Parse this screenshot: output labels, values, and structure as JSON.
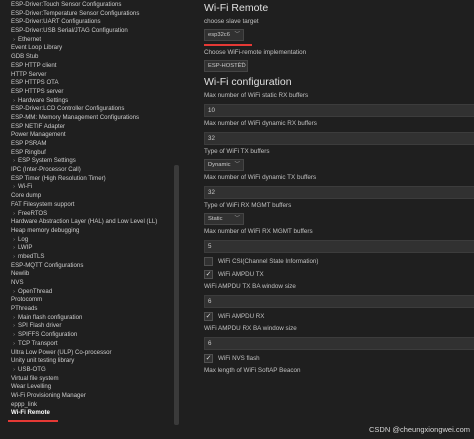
{
  "sidebar": {
    "items": [
      {
        "label": "ESP-Driver:Touch Sensor Configurations",
        "indent": 0,
        "chevron": false
      },
      {
        "label": "ESP-Driver:Temperature Sensor Configurations",
        "indent": 0,
        "chevron": false
      },
      {
        "label": "ESP-Driver:UART Configurations",
        "indent": 0,
        "chevron": false
      },
      {
        "label": "ESP-Driver:USB Serial/JTAG Configuration",
        "indent": 0,
        "chevron": false
      },
      {
        "label": "Ethernet",
        "indent": 1,
        "chevron": true
      },
      {
        "label": "Event Loop Library",
        "indent": 0,
        "chevron": false
      },
      {
        "label": "GDB Stub",
        "indent": 0,
        "chevron": false
      },
      {
        "label": "ESP HTTP client",
        "indent": 0,
        "chevron": false
      },
      {
        "label": "HTTP Server",
        "indent": 0,
        "chevron": false
      },
      {
        "label": "ESP HTTPS OTA",
        "indent": 0,
        "chevron": false
      },
      {
        "label": "ESP HTTPS server",
        "indent": 0,
        "chevron": false
      },
      {
        "label": "Hardware Settings",
        "indent": 1,
        "chevron": true
      },
      {
        "label": "ESP-Driver:LCD Controller Configurations",
        "indent": 0,
        "chevron": false
      },
      {
        "label": "ESP-MM: Memory Management Configurations",
        "indent": 0,
        "chevron": false
      },
      {
        "label": "ESP NETIF Adapter",
        "indent": 0,
        "chevron": false
      },
      {
        "label": "Power Management",
        "indent": 0,
        "chevron": false
      },
      {
        "label": "ESP PSRAM",
        "indent": 0,
        "chevron": false
      },
      {
        "label": "ESP Ringbuf",
        "indent": 0,
        "chevron": false
      },
      {
        "label": "ESP System Settings",
        "indent": 1,
        "chevron": true
      },
      {
        "label": "IPC (Inter-Processor Call)",
        "indent": 0,
        "chevron": false
      },
      {
        "label": "ESP Timer (High Resolution Timer)",
        "indent": 0,
        "chevron": false
      },
      {
        "label": "Wi-Fi",
        "indent": 1,
        "chevron": true
      },
      {
        "label": "Core dump",
        "indent": 0,
        "chevron": false
      },
      {
        "label": "FAT Filesystem support",
        "indent": 0,
        "chevron": false
      },
      {
        "label": "FreeRTOS",
        "indent": 1,
        "chevron": true
      },
      {
        "label": "Hardware Abstraction Layer (HAL) and Low Level (LL)",
        "indent": 0,
        "chevron": false
      },
      {
        "label": "Heap memory debugging",
        "indent": 0,
        "chevron": false
      },
      {
        "label": "Log",
        "indent": 1,
        "chevron": true
      },
      {
        "label": "LWIP",
        "indent": 1,
        "chevron": true
      },
      {
        "label": "mbedTLS",
        "indent": 1,
        "chevron": true
      },
      {
        "label": "ESP-MQTT Configurations",
        "indent": 0,
        "chevron": false
      },
      {
        "label": "Newlib",
        "indent": 0,
        "chevron": false
      },
      {
        "label": "NVS",
        "indent": 0,
        "chevron": false
      },
      {
        "label": "OpenThread",
        "indent": 1,
        "chevron": true
      },
      {
        "label": "Protocomm",
        "indent": 0,
        "chevron": false
      },
      {
        "label": "PThreads",
        "indent": 0,
        "chevron": false
      },
      {
        "label": "Main flash configuration",
        "indent": 1,
        "chevron": true
      },
      {
        "label": "SPI Flash driver",
        "indent": 1,
        "chevron": true
      },
      {
        "label": "SPIFFS Configuration",
        "indent": 1,
        "chevron": true
      },
      {
        "label": "TCP Transport",
        "indent": 1,
        "chevron": true
      },
      {
        "label": "Ultra Low Power (ULP) Co-processor",
        "indent": 0,
        "chevron": false
      },
      {
        "label": "Unity unit testing library",
        "indent": 0,
        "chevron": false
      },
      {
        "label": "USB-OTG",
        "indent": 1,
        "chevron": true
      },
      {
        "label": "Virtual file system",
        "indent": 0,
        "chevron": false
      },
      {
        "label": "Wear Levelling",
        "indent": 0,
        "chevron": false
      },
      {
        "label": "Wi-Fi Provisioning Manager",
        "indent": 0,
        "chevron": false
      },
      {
        "label": "eppp_link",
        "indent": 0,
        "chevron": false
      },
      {
        "label": "Wi-Fi Remote",
        "indent": 0,
        "chevron": false,
        "selected": true
      }
    ]
  },
  "main": {
    "section1_title": "Wi-Fi Remote",
    "slave_target_desc": "choose slave target",
    "slave_target_value": "esp32c6",
    "impl_desc": "Choose WiFi-remote implementation",
    "impl_value": "ESP-HOSTED",
    "section2_title": "Wi-Fi configuration",
    "static_rx_desc": "Max number of WiFi static RX buffers",
    "static_rx_value": "10",
    "dynamic_rx_desc": "Max number of WiFi dynamic RX buffers",
    "dynamic_rx_value": "32",
    "tx_type_desc": "Type of WiFi TX buffers",
    "tx_type_value": "Dynamic",
    "dynamic_tx_desc": "Max number of WiFi dynamic TX buffers",
    "dynamic_tx_value": "32",
    "rx_mgmt_type_desc": "Type of WiFi RX MGMT buffers",
    "rx_mgmt_type_value": "Static",
    "rx_mgmt_desc": "Max number of WiFi RX MGMT buffers",
    "rx_mgmt_value": "5",
    "csi_label": "WiFi CSI(Channel State Information)",
    "ampdu_tx_label": "WiFi AMPDU TX",
    "tx_ba_desc": "WiFi AMPDU TX BA window size",
    "tx_ba_value": "6",
    "ampdu_rx_label": "WiFi AMPDU RX",
    "rx_ba_desc": "WiFi AMPDU RX BA window size",
    "rx_ba_value": "6",
    "nvs_label": "WiFi NVS flash",
    "softap_beacon_desc": "Max length of WiFi SoftAP Beacon",
    "check_mark": "✓"
  },
  "watermark": "CSDN @cheungxiongwei.com"
}
